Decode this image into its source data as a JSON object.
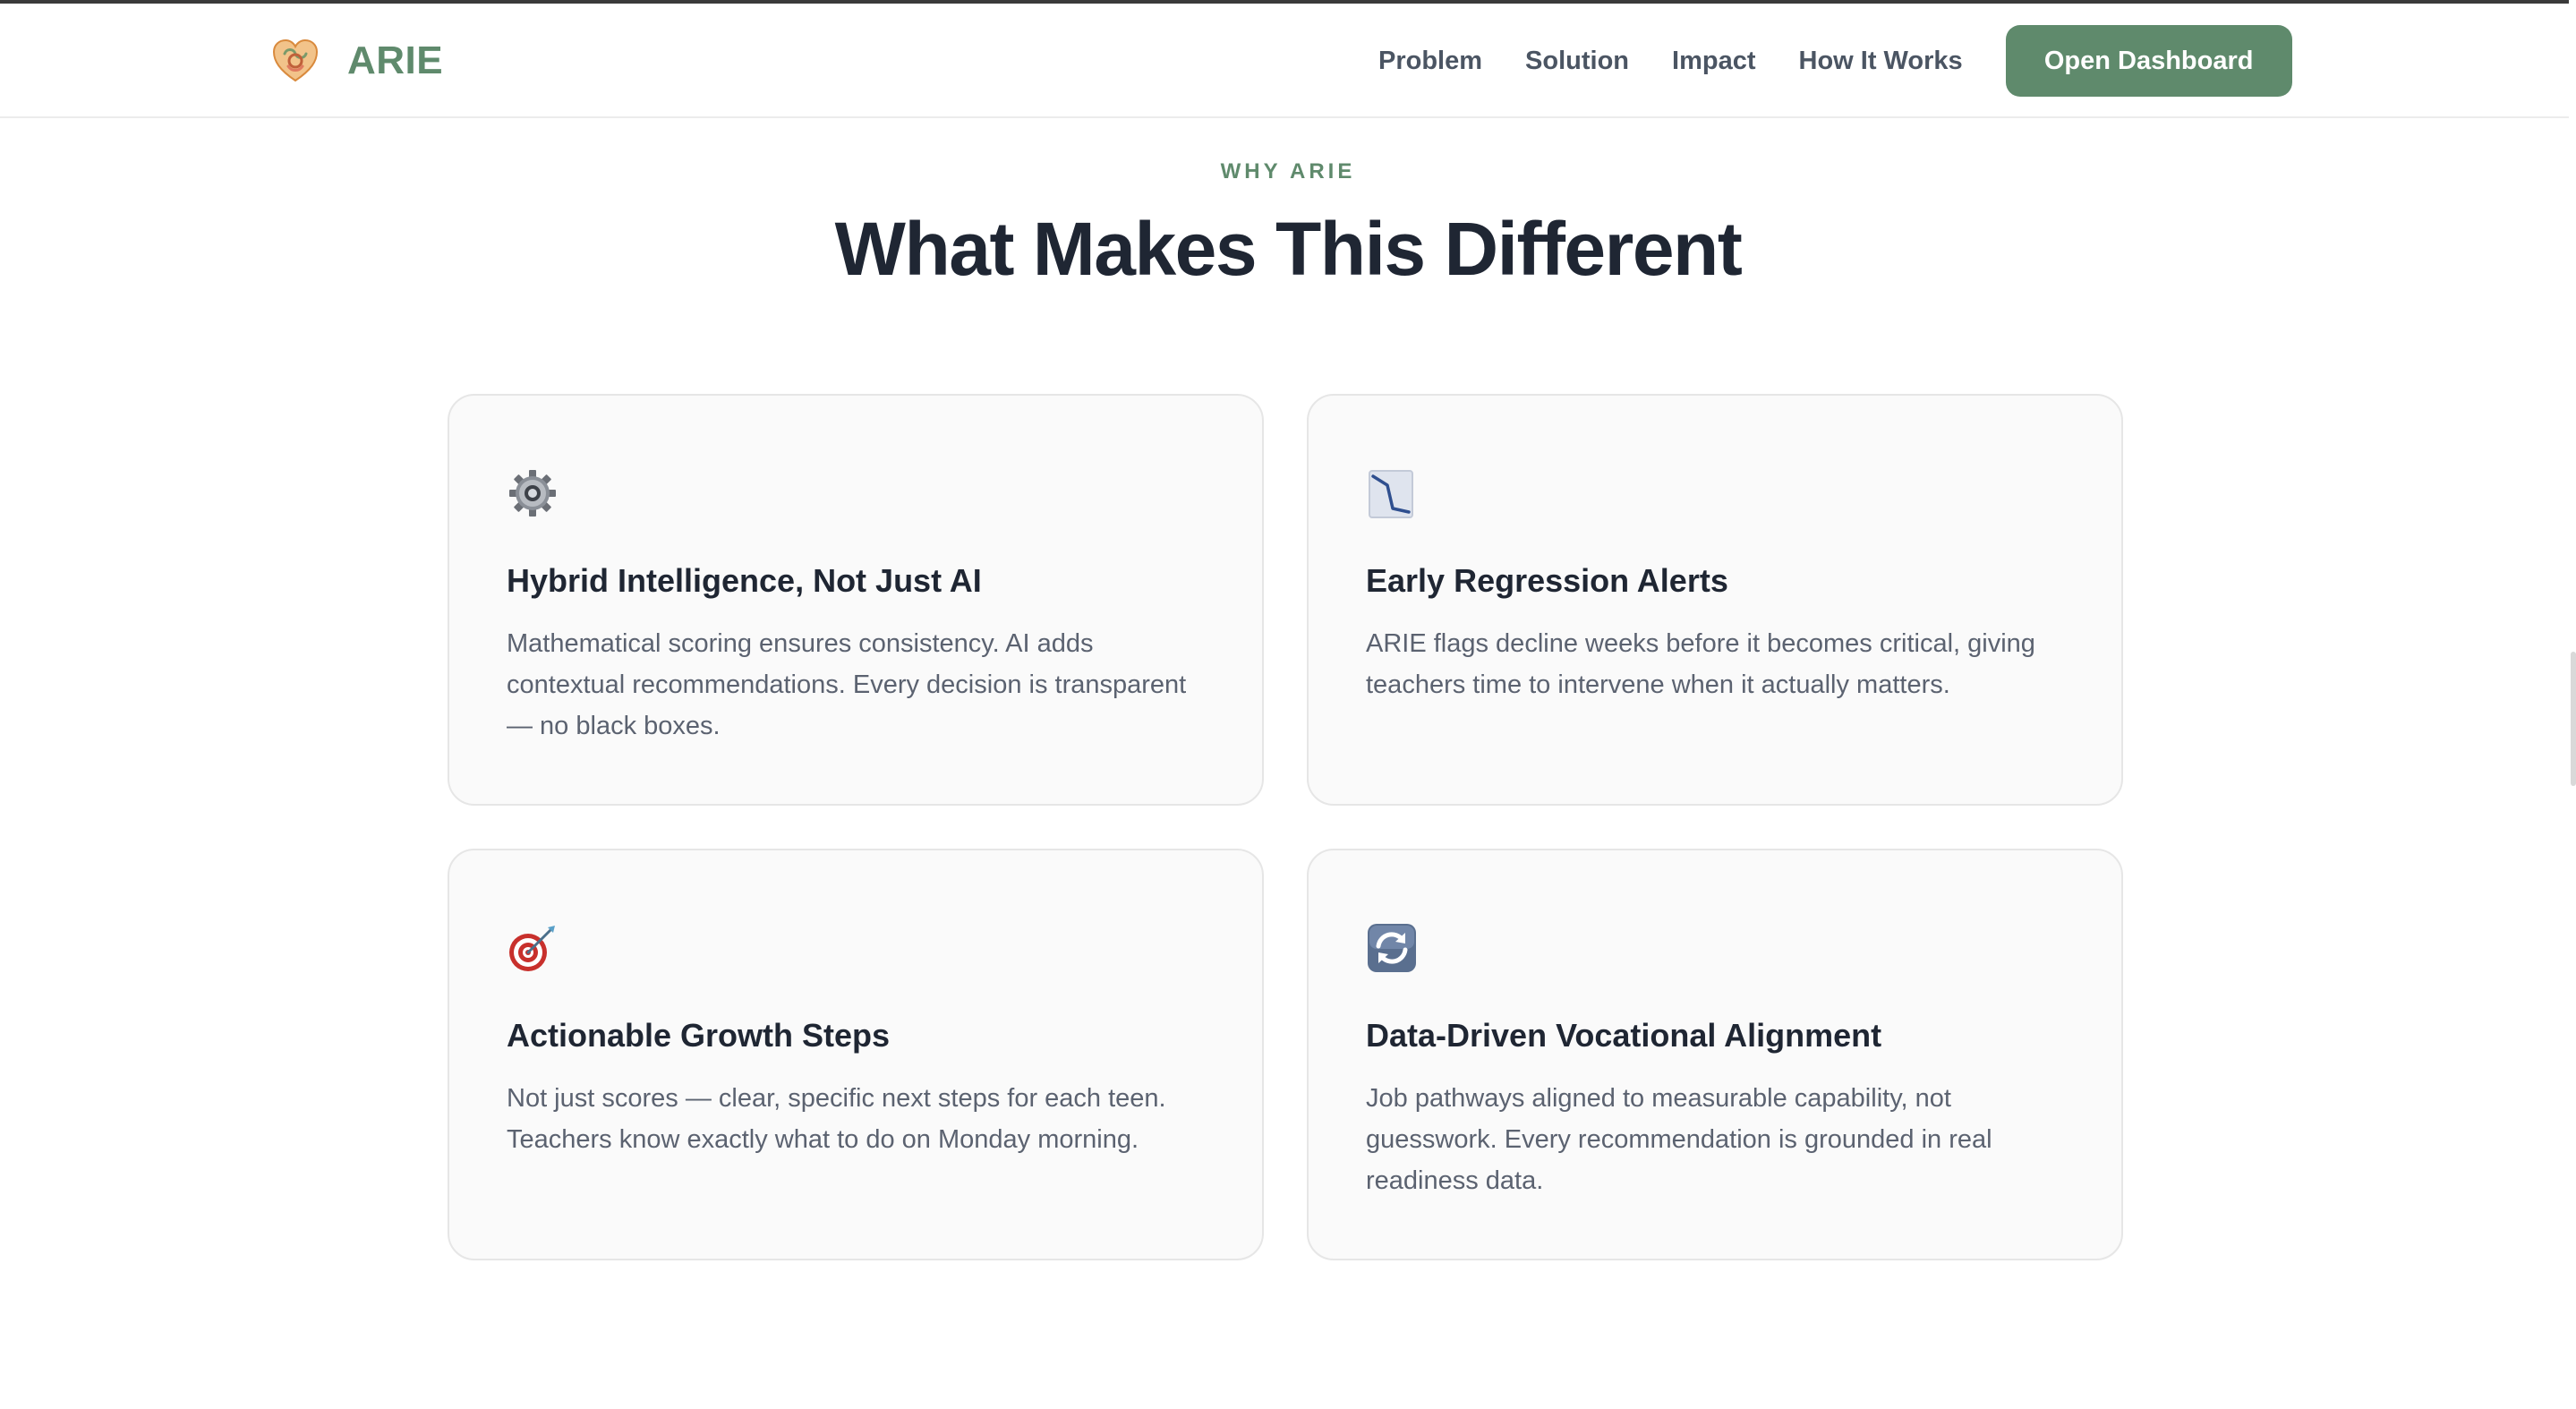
{
  "brand": {
    "name": "ARIE",
    "logo_icon": "heart-logo-icon"
  },
  "nav": {
    "links": [
      {
        "label": "Problem"
      },
      {
        "label": "Solution"
      },
      {
        "label": "Impact"
      },
      {
        "label": "How It Works"
      }
    ],
    "cta_label": "Open Dashboard"
  },
  "section": {
    "eyebrow": "WHY ARIE",
    "title": "What Makes This Different"
  },
  "features": [
    {
      "icon": "gear-icon",
      "title": "Hybrid Intelligence, Not Just AI",
      "description": "Mathematical scoring ensures consistency. AI adds contextual recommendations. Every decision is transparent — no black boxes."
    },
    {
      "icon": "chart-decreasing-icon",
      "title": "Early Regression Alerts",
      "description": "ARIE flags decline weeks before it becomes critical, giving teachers time to intervene when it actually matters."
    },
    {
      "icon": "target-icon",
      "title": "Actionable Growth Steps",
      "description": "Not just scores — clear, specific next steps for each teen. Teachers know exactly what to do on Monday morning."
    },
    {
      "icon": "refresh-icon",
      "title": "Data-Driven Vocational Alignment",
      "description": "Job pathways aligned to measurable capability, not guesswork. Every recommendation is grounded in real readiness data."
    }
  ],
  "colors": {
    "brand": "#5f8a6c",
    "heading": "#1f2633",
    "body_text": "#5b6270",
    "nav_text": "#4b5563",
    "card_bg": "#fafafa",
    "card_border": "#e6e6e6"
  }
}
